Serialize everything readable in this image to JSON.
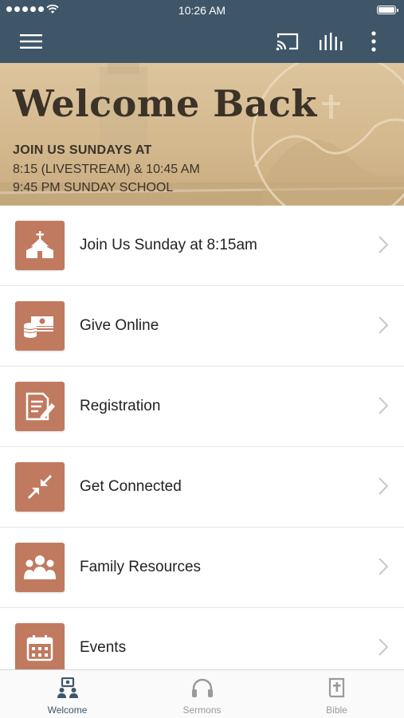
{
  "status_bar": {
    "time": "10:26 AM"
  },
  "nav_bar": {
    "menu_icon": "hamburger-icon",
    "cast_icon": "cast-icon",
    "audio_icon": "equalizer-icon",
    "more_icon": "vertical-dots-icon"
  },
  "hero": {
    "title": "Welcome Back",
    "subtitle": "JOIN US SUNDAYS AT",
    "line1": "8:15 (LIVESTREAM) & 10:45 AM",
    "line2": "9:45 PM SUNDAY SCHOOL"
  },
  "menu_items": [
    {
      "label": "Join Us Sunday at 8:15am",
      "icon": "church-icon"
    },
    {
      "label": "Give Online",
      "icon": "money-icon"
    },
    {
      "label": "Registration",
      "icon": "form-edit-icon"
    },
    {
      "label": "Get Connected",
      "icon": "connect-arrows-icon"
    },
    {
      "label": "Family Resources",
      "icon": "family-icon"
    },
    {
      "label": "Events",
      "icon": "calendar-icon"
    }
  ],
  "tabs": [
    {
      "label": "Welcome",
      "icon": "people-icon",
      "active": true
    },
    {
      "label": "Sermons",
      "icon": "headphones-icon",
      "active": false
    },
    {
      "label": "Bible",
      "icon": "bible-icon",
      "active": false
    }
  ],
  "colors": {
    "nav_bar": "#3e5668",
    "icon_tile": "#c07a60",
    "hero_bg": "#d6bb91",
    "hero_text": "#3b3228",
    "tab_active": "#3e5668",
    "tab_inactive": "#9a9a9a"
  }
}
